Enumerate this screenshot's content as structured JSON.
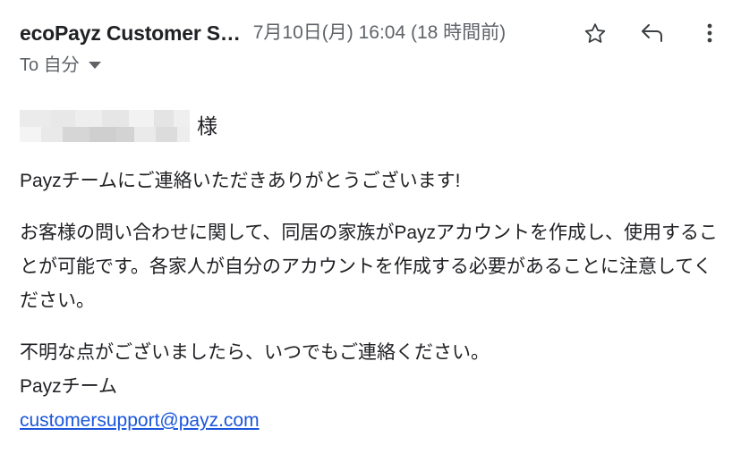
{
  "header": {
    "sender": "ecoPayz Customer S…",
    "timestamp": "7月10日(月) 16:04 (18 時間前)",
    "recipient": "To 自分",
    "actions": {
      "star": "star-outline",
      "reply": "reply-arrow",
      "more": "more-vertical"
    }
  },
  "message": {
    "salutation_redacted": "",
    "honorific": "様",
    "paragraphs": [
      "Payzチームにご連絡いただきありがとうございます!",
      "お客様の問い合わせに関して、同居の家族がPayzアカウントを作成し、使用することが可能です。各家人が自分のアカウントを作成する必要があることに注意してください。",
      "不明な点がございましたら、いつでもご連絡ください。"
    ],
    "signature": "Payzチーム",
    "contact_email": "customersupport@payz.com"
  },
  "colors": {
    "text": "#202124",
    "muted": "#5f6368",
    "link": "#1a56db",
    "background": "#ffffff"
  }
}
